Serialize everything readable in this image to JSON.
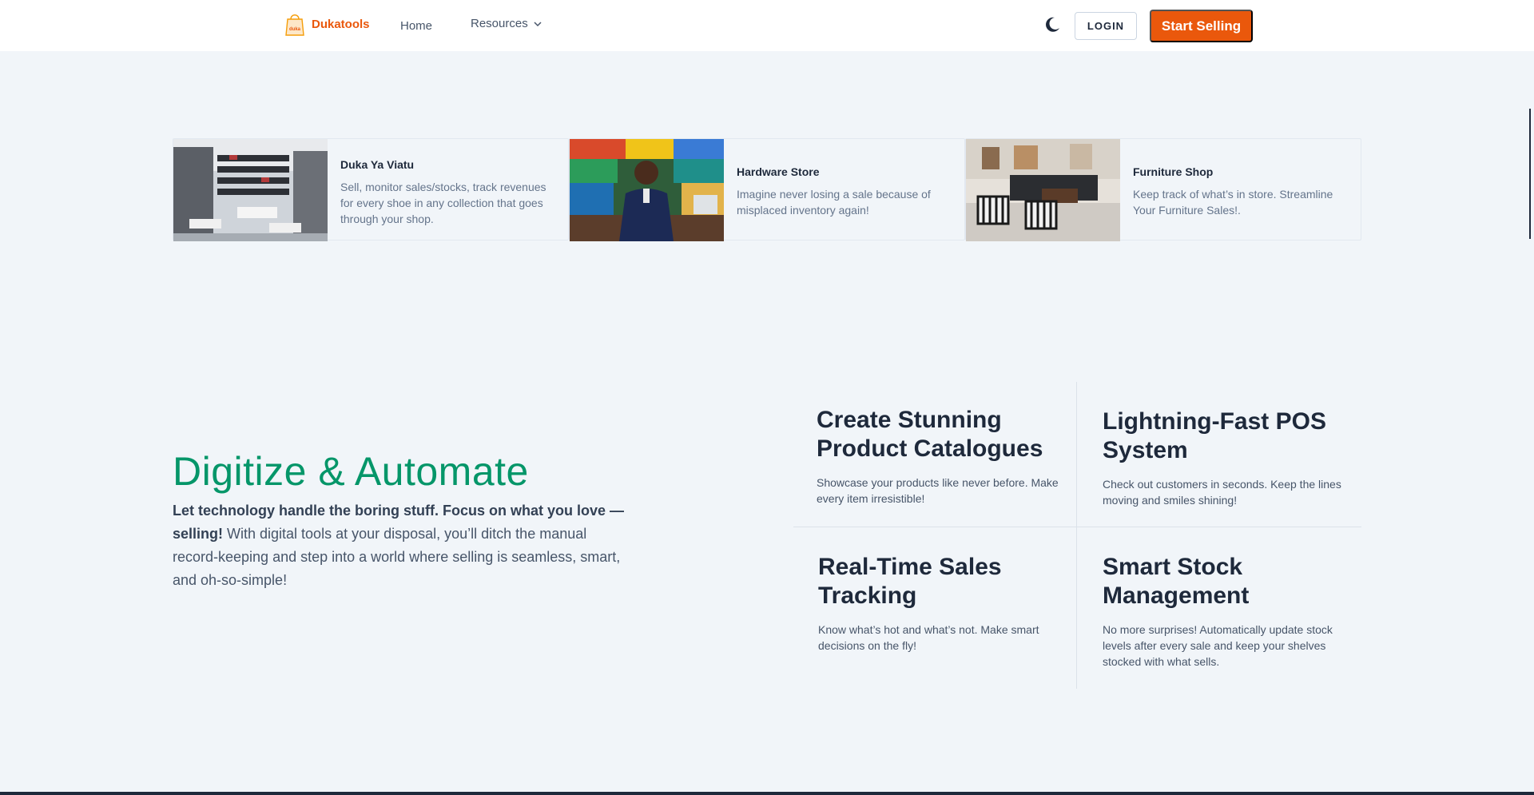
{
  "nav": {
    "brand": "Dukatools",
    "home": "Home",
    "resources": "Resources",
    "login": "LOGIN",
    "start_selling": "Start Selling"
  },
  "shops": [
    {
      "title": "Duka Ya Viatu",
      "description": "Sell, monitor sales/stocks, track revenues for every shoe in any collection that goes through your shop."
    },
    {
      "title": "Hardware Store",
      "description": "Imagine never losing a sale because of misplaced inventory again!"
    },
    {
      "title": "Furniture Shop",
      "description": "Keep track of what’s in store. Streamline Your Furniture Sales!."
    }
  ],
  "hero": {
    "title": "Digitize & Automate",
    "lead_bold": "Let technology handle the boring stuff. Focus on what you love — selling!",
    "lead_rest": " With digital tools at your disposal, you’ll ditch the manual record-keeping and step into a world where selling is seamless, smart, and oh-so-simple!"
  },
  "features": [
    {
      "title": "Create Stunning Product Catalogues",
      "description": "Showcase your products like never before. Make every item irresistible!"
    },
    {
      "title": "Lightning-Fast POS System",
      "description": "Check out customers in seconds. Keep the lines moving and smiles shining!"
    },
    {
      "title": "Real-Time Sales Tracking",
      "description": "Know what’s hot and what’s not. Make smart decisions on the fly!"
    },
    {
      "title": "Smart Stock Management",
      "description": "No more surprises! Automatically update stock levels after every sale and keep your shelves stocked with what sells."
    }
  ],
  "colors": {
    "brand_orange": "#ea580c",
    "accent_green": "#059669",
    "page_bg": "#f1f5f9"
  },
  "icons": {
    "logo": "shopping-bag-icon",
    "resources_caret": "chevron-down-icon",
    "theme_toggle": "moon-icon"
  }
}
